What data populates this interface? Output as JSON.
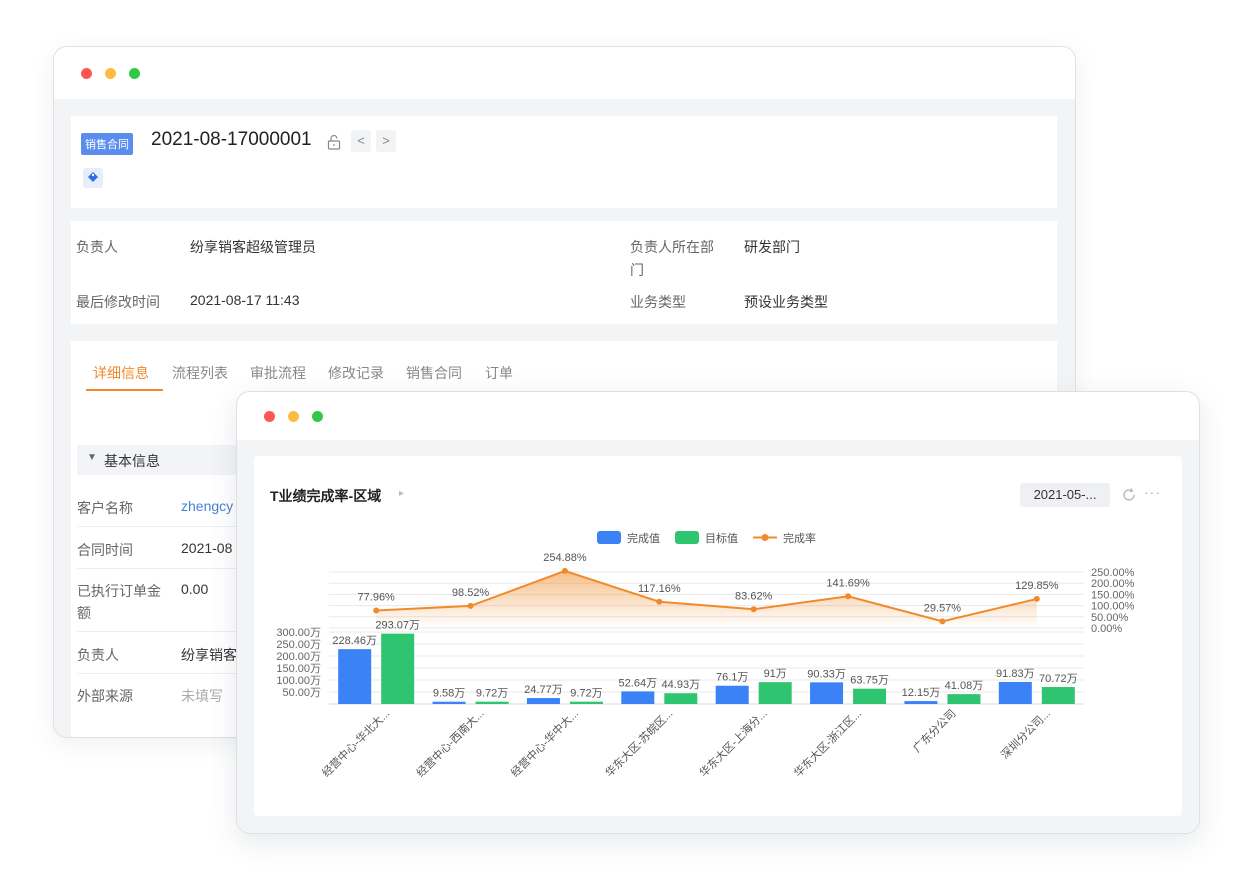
{
  "record": {
    "badge": "销售合同",
    "number": "2021-08-17000001",
    "prev": "<",
    "next": ">"
  },
  "info": {
    "owner_label": "负责人",
    "owner_value": "纷享销客超级管理员",
    "dept_label_1": "负责人所在部",
    "dept_label_2": "门",
    "dept_value": "研发部门",
    "modified_label": "最后修改时间",
    "modified_value": "2021-08-17 11:43",
    "biztype_label": "业务类型",
    "biztype_value": "预设业务类型"
  },
  "tabs": [
    "详细信息",
    "流程列表",
    "审批流程",
    "修改记录",
    "销售合同",
    "订单"
  ],
  "section": {
    "toggle": "▼",
    "title": "基本信息"
  },
  "fields": [
    {
      "label": "客户名称",
      "value": "zhengcy",
      "link": true
    },
    {
      "label": "合同时间",
      "value": "2021-08"
    },
    {
      "label": "已执行订单金",
      "label2": "额",
      "value": "0.00"
    },
    {
      "label": "负责人",
      "value": "纷享销客"
    },
    {
      "label": "外部来源",
      "value": "未填写",
      "muted": true
    }
  ],
  "chart_header": {
    "title": "T业绩完成率-区域",
    "arrow": "▸",
    "date": "2021-05-...",
    "more": "···"
  },
  "colors": {
    "bar_actual": "#3b82f6",
    "bar_target": "#2fc46f",
    "rate_line": "#f08a2b",
    "accent": "#f08a2b",
    "badge": "#5b8def"
  },
  "chart_data": {
    "type": "bar",
    "categories": [
      "经营中心-华北大...",
      "经营中心-西南大...",
      "经营中心-华中大...",
      "华东大区-苏皖区...",
      "华东大区-上海分...",
      "华东大区-浙江区...",
      "广东分公司",
      "深圳分公司..."
    ],
    "series": [
      {
        "name": "完成值",
        "type": "bar",
        "values": [
          228.46,
          9.58,
          24.77,
          52.64,
          76.1,
          90.33,
          12.15,
          91.83
        ],
        "labels": [
          "228.46万",
          "9.58万",
          "24.77万",
          "52.64万",
          "76.1万",
          "90.33万",
          "12.15万",
          "91.83万"
        ]
      },
      {
        "name": "目标值",
        "type": "bar",
        "values": [
          293.07,
          9.72,
          9.72,
          44.93,
          91,
          63.75,
          41.08,
          70.72
        ],
        "labels": [
          "293.07万",
          "9.72万",
          "9.72万",
          "44.93万",
          "91万",
          "63.75万",
          "41.08万",
          "70.72万"
        ]
      },
      {
        "name": "完成率",
        "type": "line",
        "values": [
          77.96,
          98.52,
          254.88,
          117.16,
          83.62,
          141.69,
          29.57,
          129.85
        ],
        "labels": [
          "77.96%",
          "98.52%",
          "254.88%",
          "117.16%",
          "83.62%",
          "141.69%",
          "29.57%",
          "129.85%"
        ]
      }
    ],
    "y_left_ticks": [
      "300.00万",
      "250.00万",
      "200.00万",
      "150.00万",
      "100.00万",
      "50.00万"
    ],
    "y_right_ticks": [
      "250.00%",
      "200.00%",
      "150.00%",
      "100.00%",
      "50.00%",
      "0.00%"
    ],
    "ylim_left": [
      0,
      300
    ],
    "ylim_right": [
      0,
      250
    ],
    "legend_position": "top-center",
    "grid": true
  }
}
